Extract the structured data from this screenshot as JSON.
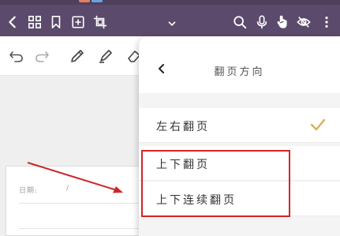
{
  "toolbar_icons": [
    "back-icon",
    "grid-icon",
    "bookmark-icon",
    "add-page-icon",
    "crop-icon",
    "chevron-down-icon",
    "search-icon",
    "microphone-icon",
    "touch-hand-icon",
    "eye-off-icon",
    "more-vertical-icon"
  ],
  "drawing_tools": [
    "undo-icon",
    "redo-icon",
    "pen-icon",
    "highlighter-icon",
    "eraser-icon"
  ],
  "document": {
    "date_label": "日期:",
    "date_separator": "/"
  },
  "panel": {
    "title": "翻页方向",
    "options": [
      {
        "label": "左右翻页",
        "selected": true
      },
      {
        "label": "上下翻页",
        "selected": false
      },
      {
        "label": "上下连续翻页",
        "selected": false
      }
    ]
  },
  "colors": {
    "topbar": "#5b4a6b",
    "check": "#d6b25a",
    "annotation": "#d0262a"
  }
}
